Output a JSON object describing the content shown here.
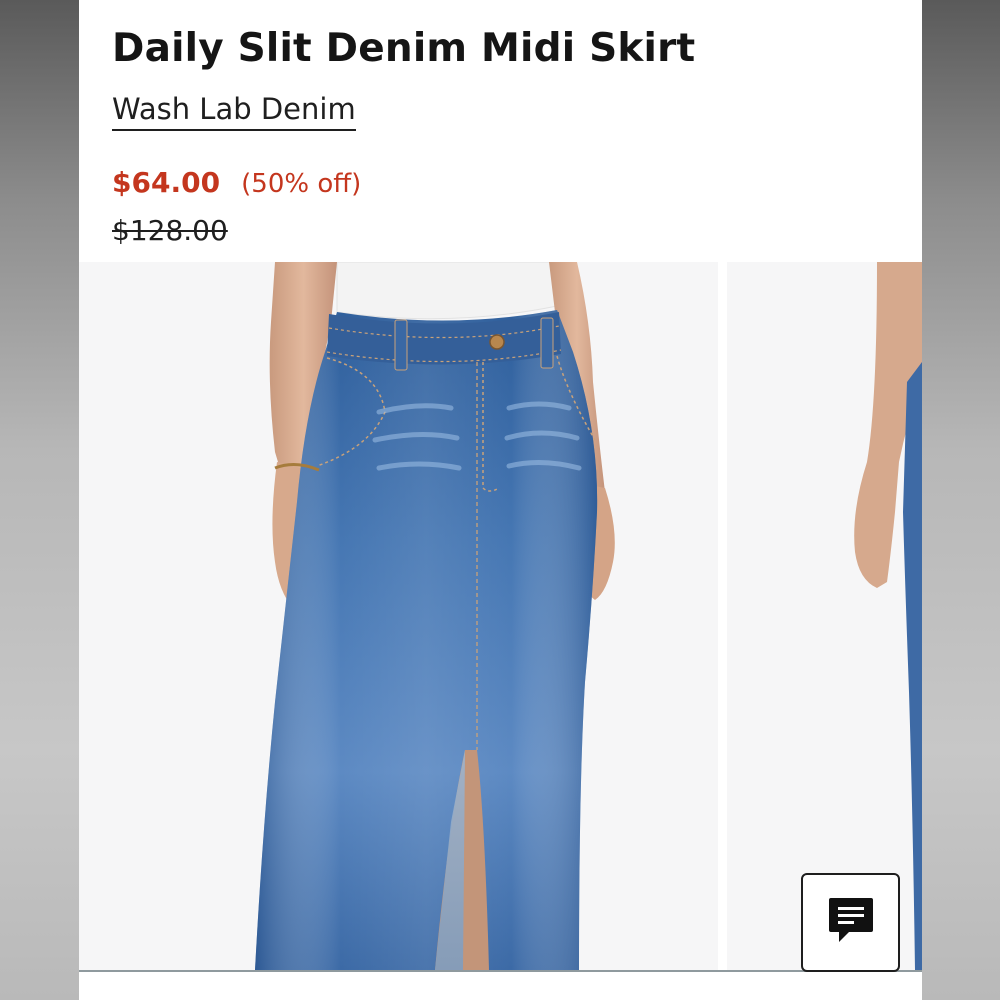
{
  "product": {
    "title": "Daily Slit Denim Midi Skirt",
    "brand": "Wash Lab Denim",
    "sale_price": "$64.00",
    "discount": "(50% off)",
    "original_price": "$128.00"
  },
  "colors": {
    "sale_red": "#c4361e",
    "text": "#151515",
    "denim": "#3f6aa3"
  },
  "gallery": {
    "images": [
      "product-photo-front",
      "product-photo-side"
    ]
  },
  "chat": {
    "icon": "chat-bubble-icon"
  }
}
